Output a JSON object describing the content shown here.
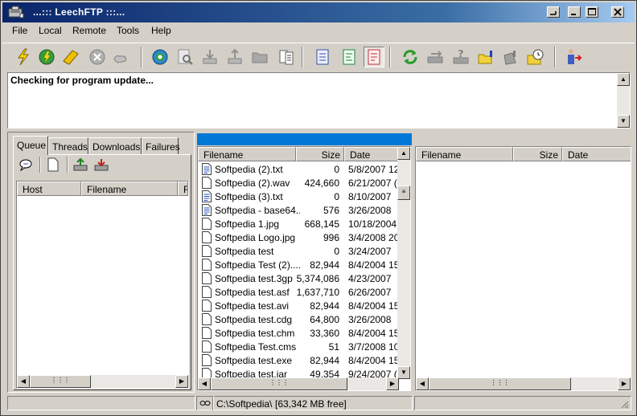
{
  "window": {
    "title": "...::: LeechFTP :::..."
  },
  "menu": [
    "File",
    "Local",
    "Remote",
    "Tools",
    "Help"
  ],
  "toolbar": {
    "buttons": [
      "connect-icon",
      "quick-connect-icon",
      "bookmarks-icon",
      "disconnect-icon",
      "abort-icon",
      "refresh-icon",
      "view-icon",
      "download-icon",
      "upload-icon",
      "new-folder-icon",
      "properties-icon",
      "binary-mode-icon",
      "ascii-mode-icon",
      "auto-mode-icon",
      "sync-icon",
      "transfer-icon",
      "queue-icon",
      "local-folder-icon",
      "remote-folder-icon",
      "schedule-icon",
      "exit-icon"
    ]
  },
  "log": {
    "text": "Checking for program update..."
  },
  "left": {
    "tabs": [
      "Queue",
      "Threads",
      "Downloads",
      "Failures"
    ],
    "active_tab": "Queue",
    "columns": [
      "Host",
      "Filename",
      "F"
    ]
  },
  "local": {
    "progress_fraction": 1.0,
    "columns": [
      "Filename",
      "Size",
      "Date"
    ],
    "files": [
      {
        "name": "Softpedia (2).txt",
        "size": "0",
        "date": "5/8/2007",
        "more": "12",
        "icon": "text"
      },
      {
        "name": "Softpedia (2).wav",
        "size": "424,660",
        "date": "6/21/2007",
        "more": "(",
        "icon": "file"
      },
      {
        "name": "Softpedia (3).txt",
        "size": "0",
        "date": "8/10/2007",
        "more": "",
        "icon": "text"
      },
      {
        "name": "Softpedia - base64...",
        "size": "576",
        "date": "3/26/2008",
        "more": "",
        "icon": "text"
      },
      {
        "name": "Softpedia 1.jpg",
        "size": "668,145",
        "date": "10/18/2004",
        "more": "",
        "icon": "file"
      },
      {
        "name": "Softpedia Logo.jpg",
        "size": "996",
        "date": "3/4/2008",
        "more": "20",
        "icon": "file"
      },
      {
        "name": "Softpedia test",
        "size": "0",
        "date": "3/24/2007",
        "more": "",
        "icon": "file"
      },
      {
        "name": "Softpedia Test (2)....",
        "size": "82,944",
        "date": "8/4/2004",
        "more": "15",
        "icon": "file"
      },
      {
        "name": "Softpedia test.3gp",
        "size": "5,374,086",
        "date": "4/23/2007",
        "more": "",
        "icon": "file"
      },
      {
        "name": "Softpedia test.asf",
        "size": "1,637,710",
        "date": "6/26/2007",
        "more": "",
        "icon": "file"
      },
      {
        "name": "Softpedia test.avi",
        "size": "82,944",
        "date": "8/4/2004",
        "more": "15",
        "icon": "file"
      },
      {
        "name": "Softpedia test.cdg",
        "size": "64,800",
        "date": "3/26/2008",
        "more": "",
        "icon": "file"
      },
      {
        "name": "Softpedia test.chm",
        "size": "33,360",
        "date": "8/4/2004",
        "more": "15",
        "icon": "file"
      },
      {
        "name": "Softpedia Test.cms",
        "size": "51",
        "date": "3/7/2008",
        "more": "10",
        "icon": "file"
      },
      {
        "name": "Softpedia test.exe",
        "size": "82,944",
        "date": "8/4/2004",
        "more": "15",
        "icon": "file"
      },
      {
        "name": "Softpedia test.jar",
        "size": "49,354",
        "date": "9/24/2007",
        "more": "(",
        "icon": "file"
      }
    ],
    "status_path": "C:\\Softpedia\\",
    "status_free": "[63,342 MB free]"
  },
  "remote": {
    "columns": [
      "Filename",
      "Size",
      "Date"
    ]
  }
}
